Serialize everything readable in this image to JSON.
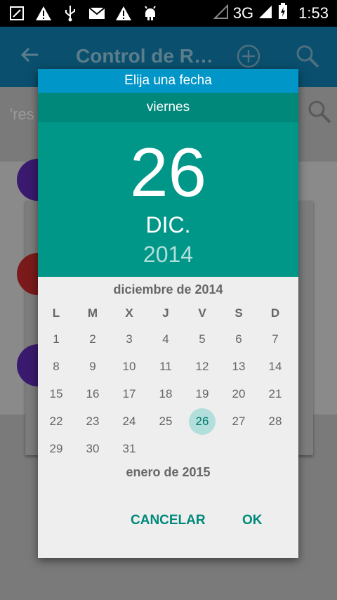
{
  "status_bar": {
    "network": "3G",
    "time": "1:53"
  },
  "app_bar": {
    "title": "Control de R…"
  },
  "search_strip": {
    "text": "'res"
  },
  "dialog": {
    "title": "Elija una fecha",
    "weekday": "viernes",
    "day": "26",
    "month": "DIC.",
    "year": "2014",
    "month_title": "diciembre de 2014",
    "weekdays": [
      "L",
      "M",
      "X",
      "J",
      "V",
      "S",
      "D"
    ],
    "selected_day": 26,
    "next_month_title": "enero de 2015",
    "cancel_label": "CANCELAR",
    "ok_label": "OK"
  },
  "colors": {
    "accent": "#009688",
    "title_bar": "#0096c8",
    "selected_day_bg": "#b2dfdb"
  }
}
